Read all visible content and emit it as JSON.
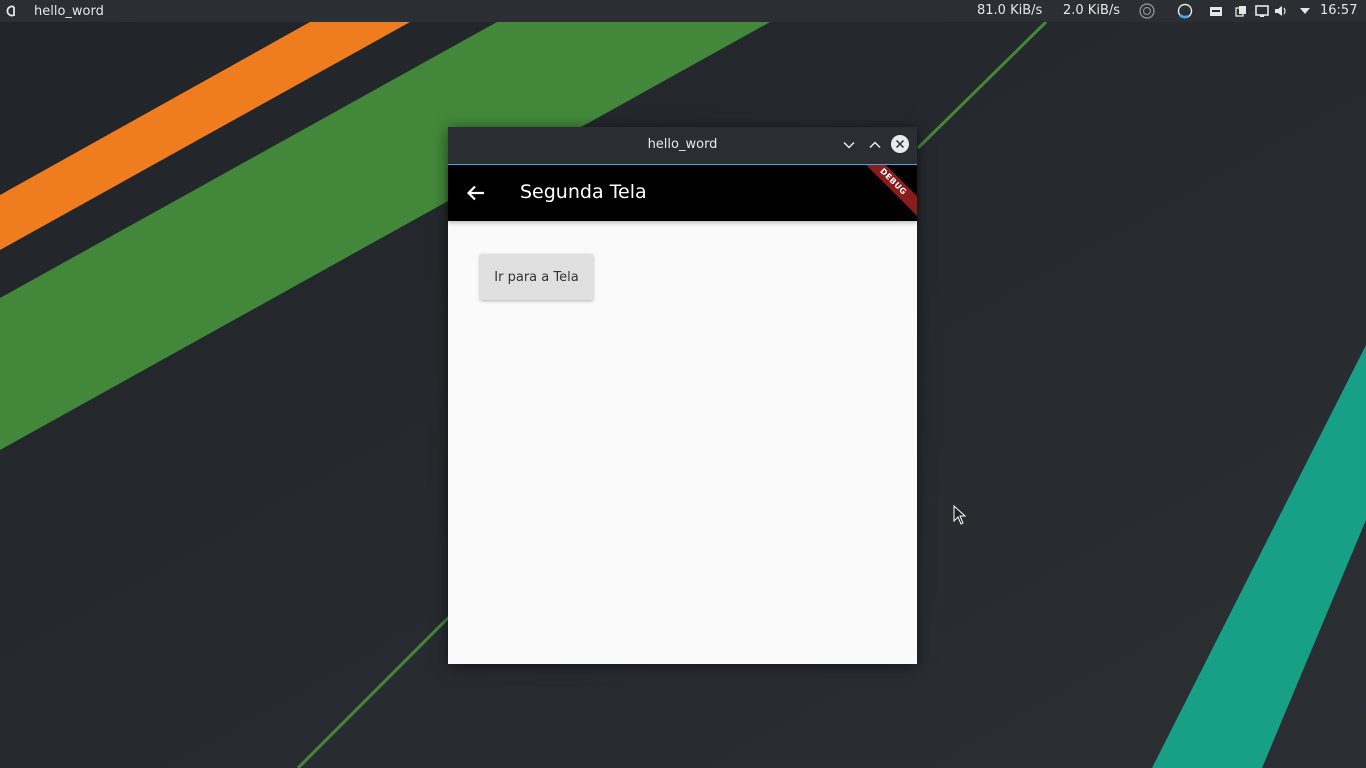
{
  "panel": {
    "active_window_title": "hello_word",
    "net_down": "81.0 KiB/s",
    "net_up": "2.0 KiB/s",
    "clock": "16:57",
    "icons": [
      "launcher-icon",
      "vpn-icon",
      "sync-icon",
      "storage-icon",
      "clipboard-icon",
      "display-icon",
      "volume-icon",
      "tray-expand-icon"
    ]
  },
  "window": {
    "title": "hello_word"
  },
  "app": {
    "appbar_title": "Segunda Tela",
    "debug_label": "DEBUG",
    "button_label": "Ir para a Tela"
  },
  "colors": {
    "orange_stripe": "#ef7d1f",
    "green_stripe": "#43883a",
    "teal_stripe": "#17a085",
    "panel_accent": "#3daee9",
    "debug_banner": "#8b1c1c"
  }
}
